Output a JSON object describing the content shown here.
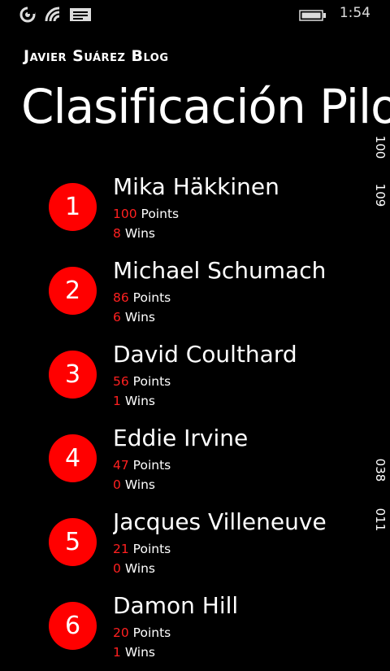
{
  "status_bar": {
    "time": "1:54",
    "icons": [
      "sync-icon",
      "wifi-icon",
      "message-icon",
      "battery-icon"
    ]
  },
  "header": {
    "app_title": "Javier Suárez Blog",
    "page_title": "Clasificación Pilotos"
  },
  "labels": {
    "points": "Points",
    "wins": "Wins"
  },
  "drivers": [
    {
      "position": "1",
      "name": "Mika Häkkinen",
      "points": "100",
      "wins": "8"
    },
    {
      "position": "2",
      "name": "Michael Schumacher",
      "points": "86",
      "wins": "6"
    },
    {
      "position": "3",
      "name": "David Coulthard",
      "points": "56",
      "wins": "1"
    },
    {
      "position": "4",
      "name": "Eddie Irvine",
      "points": "47",
      "wins": "0"
    },
    {
      "position": "5",
      "name": "Jacques Villeneuve",
      "points": "21",
      "wins": "0"
    },
    {
      "position": "6",
      "name": "Damon Hill",
      "points": "20",
      "wins": "1"
    }
  ],
  "edge_numbers": [
    "100",
    "109",
    "038",
    "011"
  ],
  "colors": {
    "accent": "#ff0000",
    "background": "#000000",
    "text": "#ffffff"
  }
}
